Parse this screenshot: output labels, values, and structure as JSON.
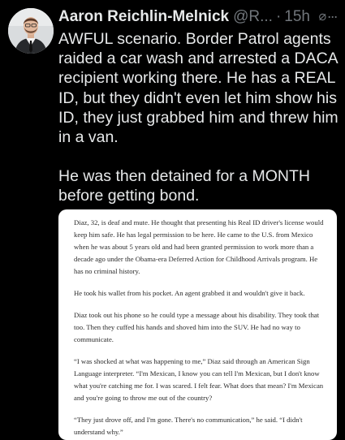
{
  "author": {
    "name": "Aaron Reichlin-Melnick",
    "handle": "@R...",
    "time": "15h",
    "avatar_icon": "person-avatar",
    "grok_icon": "grok-icon",
    "more_icon": "more-options-icon"
  },
  "tweet": {
    "paragraphs": [
      "AWFUL scenario. Border Patrol agents raided a car wash and arrested a DACA recipient working there. He has a REAL ID, but they didn't even let him show his ID, they just grabbed him and threw him in a van.",
      "He was then detained for a MONTH before getting bond."
    ]
  },
  "article": {
    "paragraphs": [
      "Diaz, 32, is deaf and mute. He thought that presenting his Real ID driver's license would keep him safe. He has legal permission to be here. He came to the U.S. from Mexico when he was about 5 years old and had been granted permission to work more than a decade ago under the Obama-era Deferred Action for Childhood Arrivals program. He has no criminal history.",
      "He took his wallet from his pocket. An agent grabbed it and wouldn't give it back.",
      "Diaz took out his phone so he could type a message about his disability. They took that too. Then they cuffed his hands and shoved him into the SUV. He had no way to communicate.",
      "“I was shocked at what was happening to me,” Diaz said through an American Sign Language interpreter. “I'm Mexican, I know you can tell I'm Mexican, but I don't know what you're catching me for. I was scared. I felt fear. What does that mean? I'm Mexican and you're going to throw me out of the country?",
      "“They just drove off, and I'm gone. There's no communication,” he said. “I didn't understand why.”"
    ]
  },
  "colors": {
    "background": "#000000",
    "text": "#e7e9ea",
    "muted": "#71767b",
    "article_bg": "#ffffff",
    "article_text": "#2a2a2a"
  }
}
